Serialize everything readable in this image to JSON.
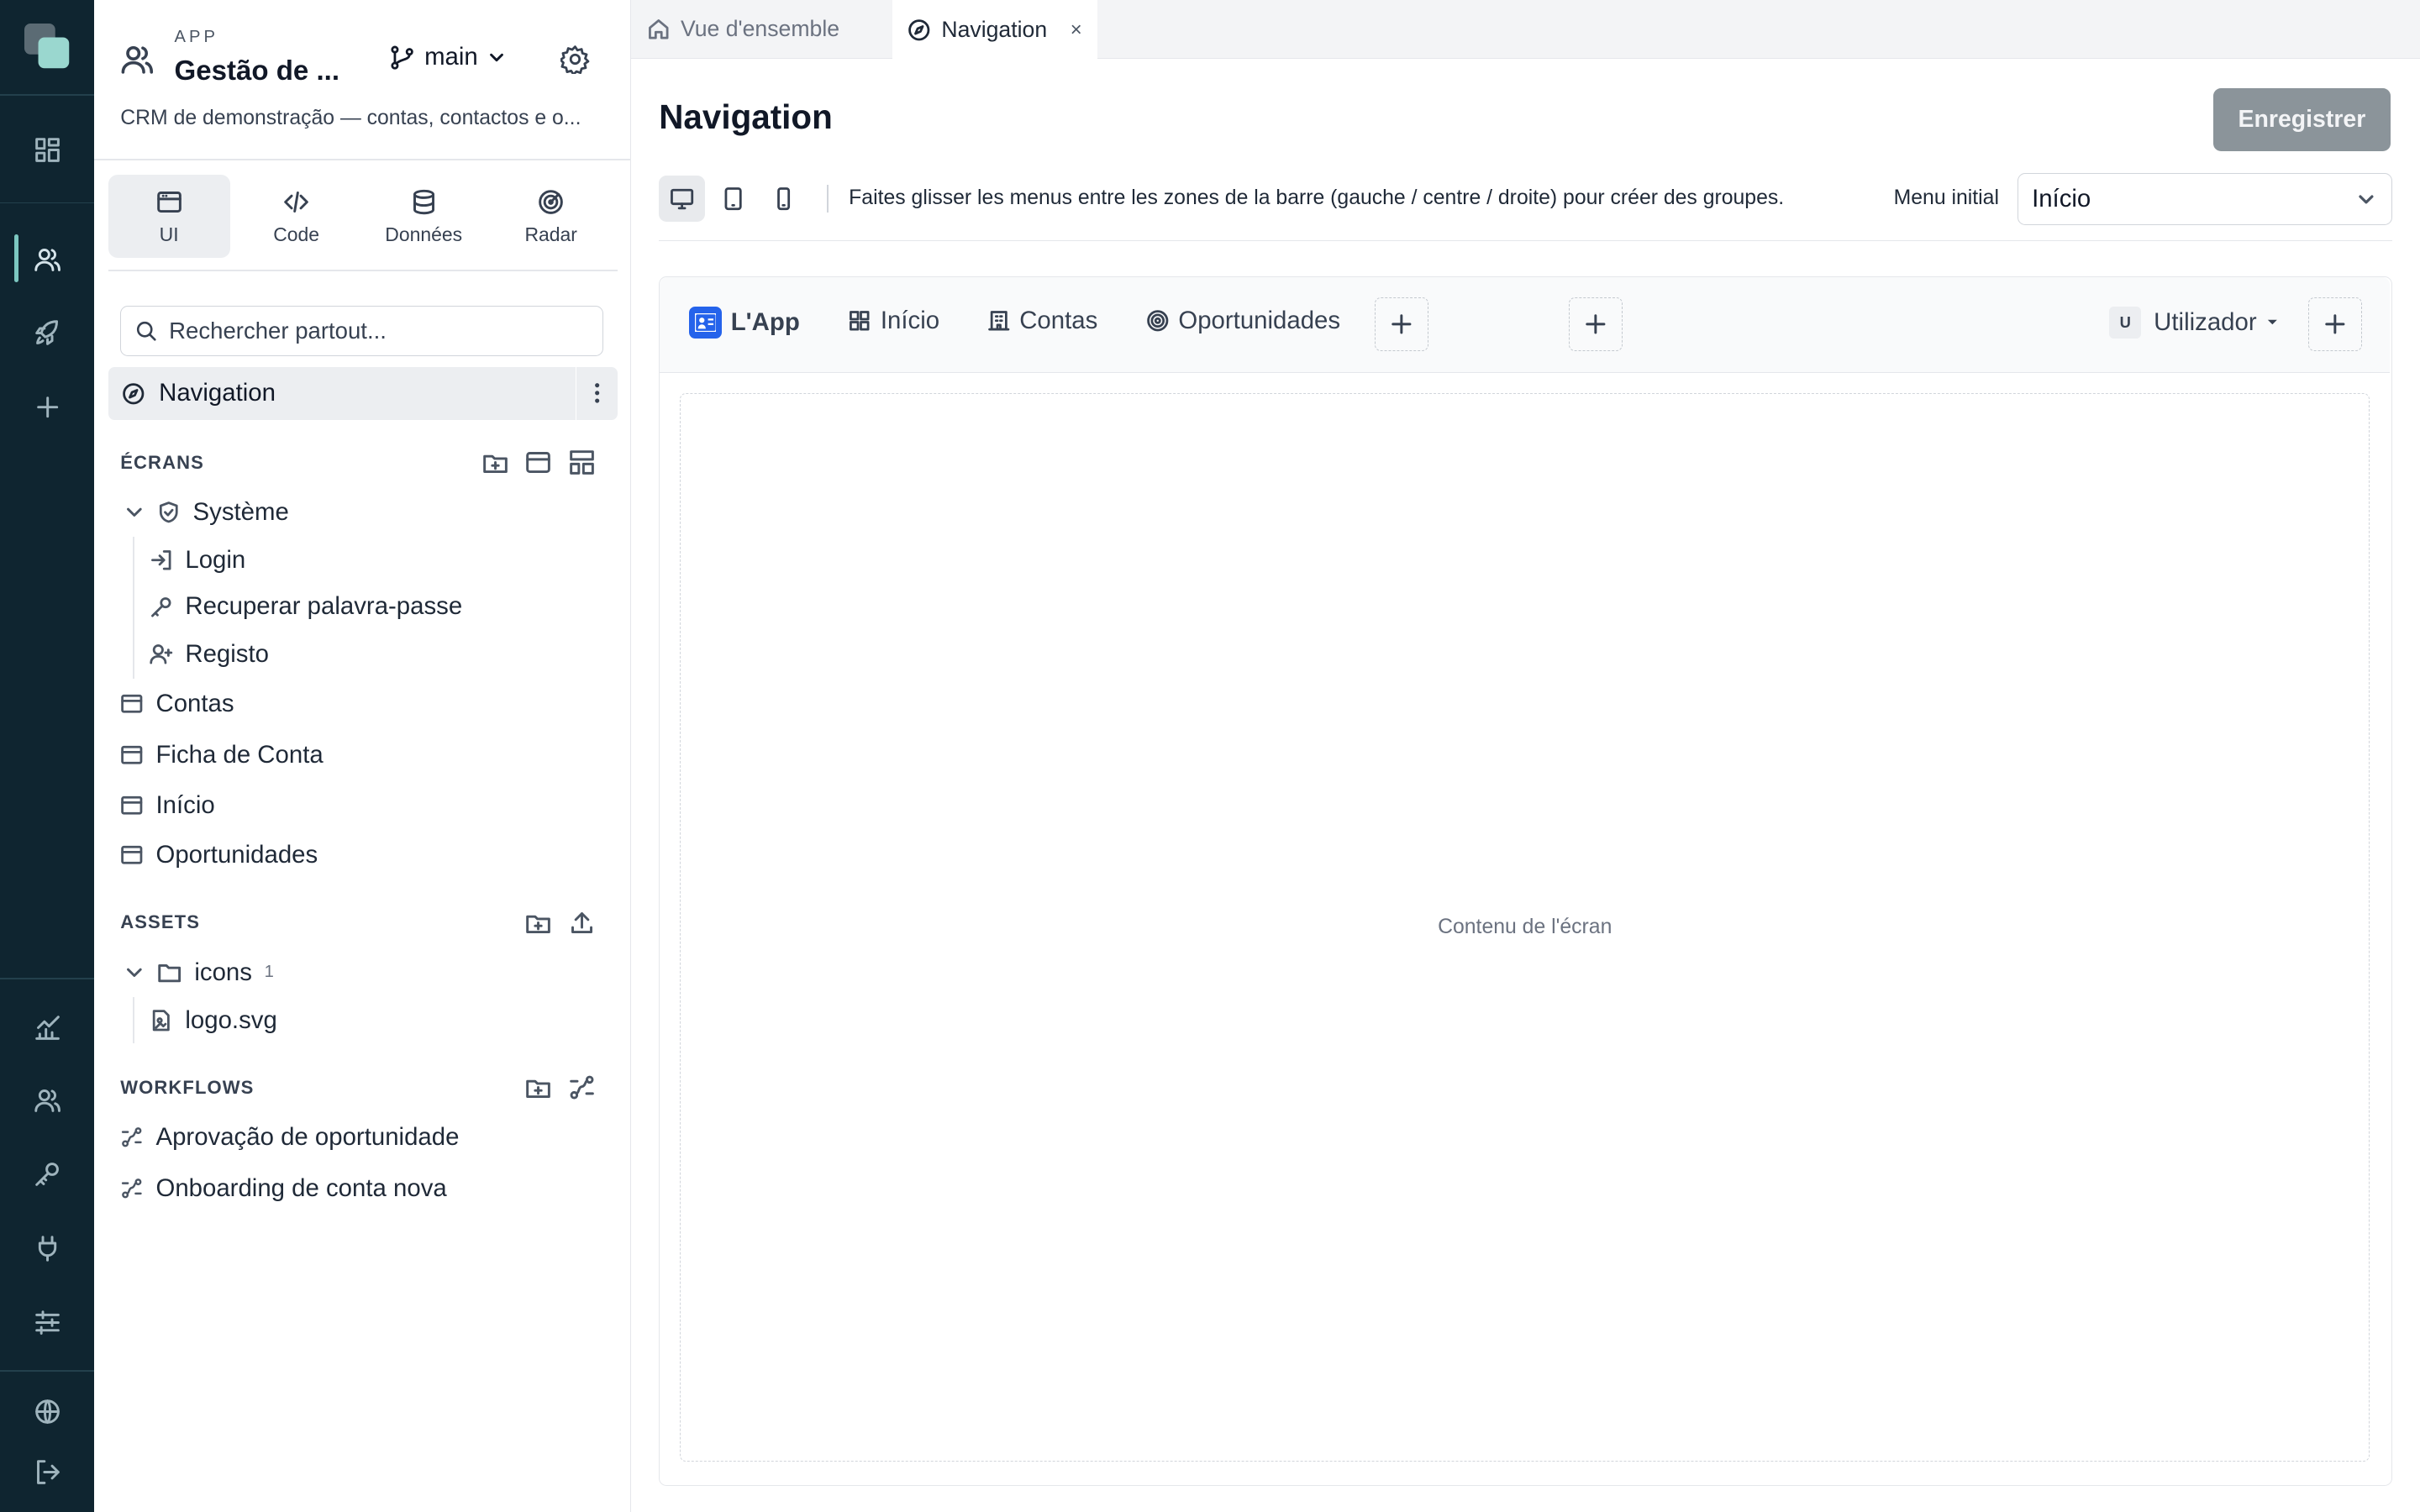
{
  "app": {
    "kicker": "APP",
    "title": "Gestão de ...",
    "branch": "main",
    "description": "CRM de demonstração — contas, contactos e o..."
  },
  "mode_tabs": [
    {
      "label": "UI",
      "icon": "window-icon",
      "active": true
    },
    {
      "label": "Code",
      "icon": "code-icon",
      "active": false
    },
    {
      "label": "Données",
      "icon": "database-icon",
      "active": false
    },
    {
      "label": "Radar",
      "icon": "radar-icon",
      "active": false
    }
  ],
  "search": {
    "placeholder": "Rechercher partout..."
  },
  "selected_item": {
    "label": "Navigation"
  },
  "screens": {
    "heading": "ÉCRANS",
    "folder": "Système",
    "folder_children": [
      "Login",
      "Recuperar palavra-passe",
      "Registo"
    ],
    "items": [
      "Contas",
      "Ficha de Conta",
      "Início",
      "Oportunidades"
    ]
  },
  "assets": {
    "heading": "ASSETS",
    "folder": "icons",
    "folder_count": "1",
    "files": [
      "logo.svg"
    ]
  },
  "workflows": {
    "heading": "WORKFLOWS",
    "items": [
      "Aprovação de oportunidade",
      "Onboarding de conta nova"
    ]
  },
  "tabs": [
    {
      "label": "Vue d'ensemble",
      "icon": "home-icon",
      "active": false
    },
    {
      "label": "Navigation",
      "icon": "compass-icon",
      "active": true,
      "close": "×"
    }
  ],
  "page": {
    "title": "Navigation",
    "save_label": "Enregistrer",
    "hint": "Faites glisser les menus entre les zones de la barre (gauche / centre / droite) pour créer des groupes.",
    "initial_menu_label": "Menu initial",
    "initial_menu_value": "Início"
  },
  "preview": {
    "brand": "L'App",
    "menus": [
      {
        "label": "Início",
        "icon": "grid-icon"
      },
      {
        "label": "Contas",
        "icon": "building-icon"
      },
      {
        "label": "Oportunidades",
        "icon": "target-icon"
      }
    ],
    "user_initial": "U",
    "user_label": "Utilizador",
    "content_placeholder": "Contenu de l'écran"
  },
  "colors": {
    "rail_bg": "#0f2530",
    "accent": "#7cc7c0",
    "brand_blue": "#2563eb",
    "save_button": "#8b949a"
  }
}
